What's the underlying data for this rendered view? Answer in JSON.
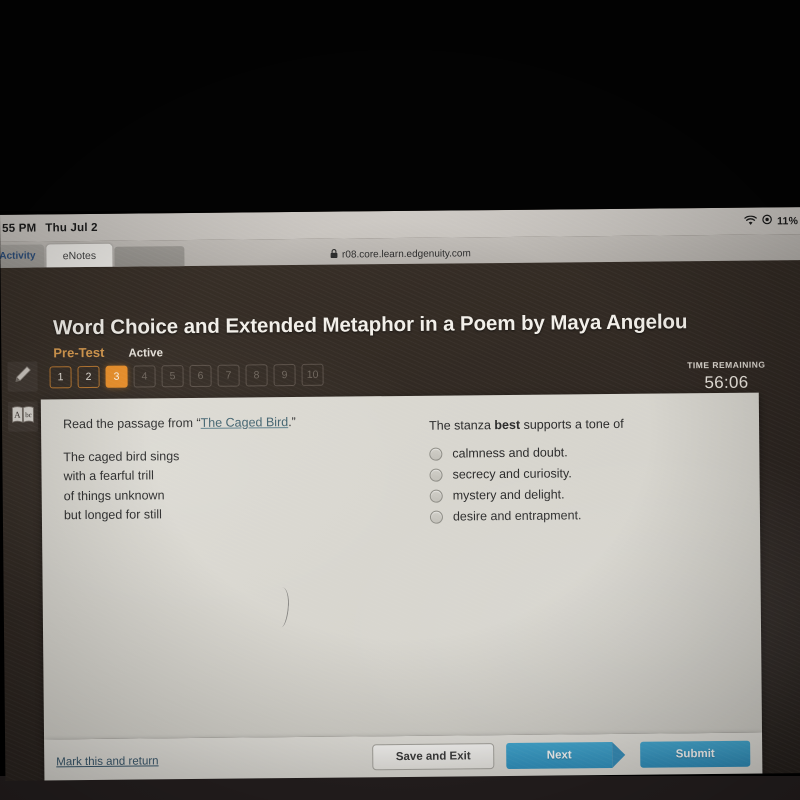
{
  "status_bar": {
    "time": "55 PM",
    "date": "Thu Jul 2",
    "wifi_icon": "wifi-icon",
    "location_icon": "location-icon",
    "battery": "11%"
  },
  "browser": {
    "tab_previous_label": "Activity",
    "tab_active_label": "eNotes",
    "lock_icon": "lock-icon",
    "url": "r08.core.learn.edgenuity.com"
  },
  "header": {
    "title": "Word Choice and Extended Metaphor in a Poem by Maya Angelou",
    "assignment_type": "Pre-Test",
    "status": "Active"
  },
  "tools": [
    {
      "name": "highlighter-tool",
      "icon": "pencil-icon"
    },
    {
      "name": "dictionary-tool",
      "icon": "dictionary-icon"
    }
  ],
  "question_nav": {
    "items": [
      {
        "label": "1",
        "state": "done"
      },
      {
        "label": "2",
        "state": "done"
      },
      {
        "label": "3",
        "state": "current"
      },
      {
        "label": "4",
        "state": "todo"
      },
      {
        "label": "5",
        "state": "todo"
      },
      {
        "label": "6",
        "state": "todo"
      },
      {
        "label": "7",
        "state": "todo"
      },
      {
        "label": "8",
        "state": "todo"
      },
      {
        "label": "9",
        "state": "todo"
      },
      {
        "label": "10",
        "state": "todo"
      }
    ]
  },
  "timer": {
    "label": "TIME REMAINING",
    "value": "56:06"
  },
  "passage": {
    "prompt_before": "Read the passage from “",
    "prompt_link": "The Caged Bird",
    "prompt_after": ".”",
    "lines": [
      "The caged bird sings",
      "with a fearful trill",
      "of things unknown",
      "but longed for still"
    ]
  },
  "question": {
    "stem_before": "The stanza ",
    "stem_emphasis": "best",
    "stem_after": " supports a tone of",
    "options": [
      {
        "label": "calmness and doubt.",
        "selected": false
      },
      {
        "label": "secrecy and curiosity.",
        "selected": false
      },
      {
        "label": "mystery and delight.",
        "selected": false
      },
      {
        "label": "desire and entrapment.",
        "selected": false
      }
    ]
  },
  "footer": {
    "mark_link": "Mark this and return",
    "save_label": "Save and Exit",
    "next_label": "Next",
    "submit_label": "Submit"
  },
  "colors": {
    "accent_orange": "#ea8f29",
    "accent_blue": "#3fa9d4",
    "link_blue": "#39586d",
    "panel_bg": "#dddbd4",
    "chrome_dark": "#332b24"
  }
}
